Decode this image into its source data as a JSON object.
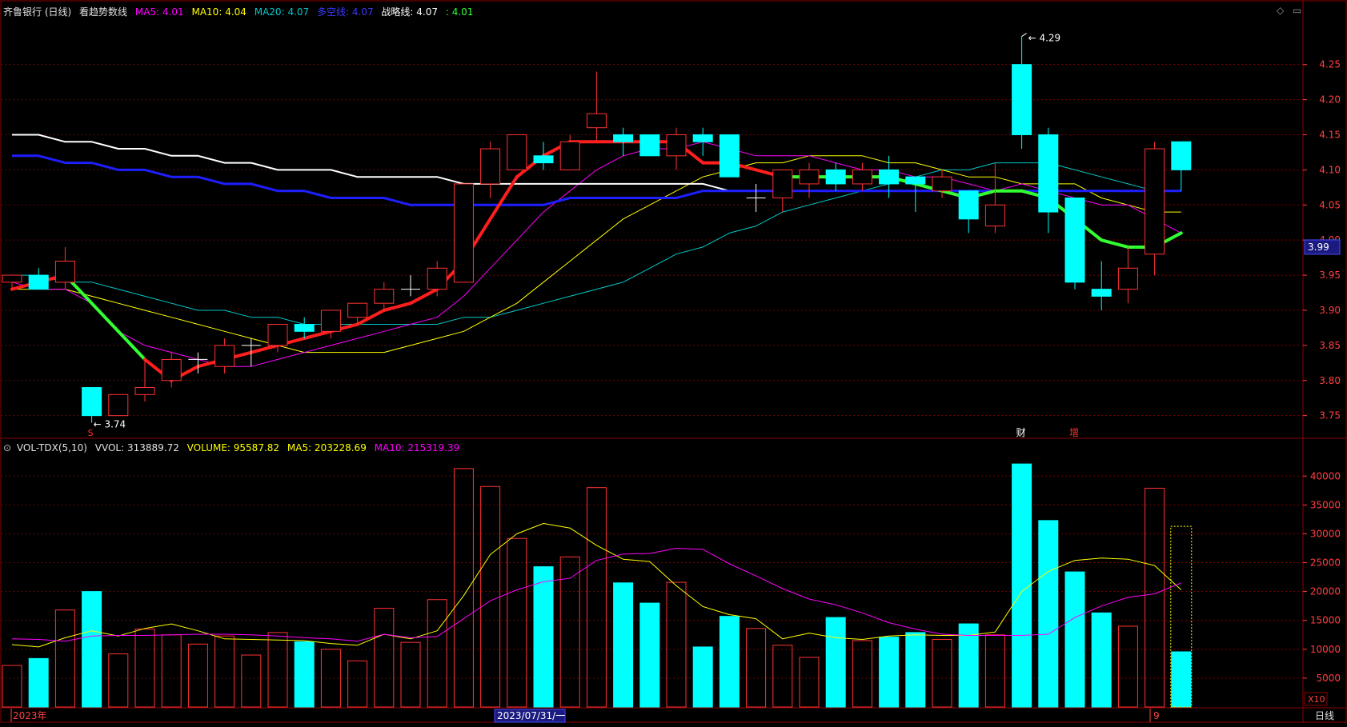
{
  "colors": {
    "up": "#ff3232",
    "down": "#00ffff",
    "grid": "#7a0000",
    "frame": "#8b0000",
    "ma5": "#ff00ff",
    "ma10": "#ffff00",
    "ma20": "#00c8c8",
    "duokong": "#1e1eff",
    "zhanlue": "#ffffff",
    "trend_red": "#ff1e1e",
    "trend_green": "#32ff32",
    "axis_text": "#ff4040",
    "price_label_bg": "#1a1a80"
  },
  "header": {
    "title": "齐鲁银行 (日线)",
    "indicator": "看趋势数线",
    "ma5_label": "MA5:",
    "ma5_value": "4.01",
    "ma10_label": "MA10:",
    "ma10_value": "4.04",
    "ma20_label": "MA20:",
    "ma20_value": "4.07",
    "duokong_label": "多空线:",
    "duokong_value": "4.07",
    "zhanlue_label": "战略线:",
    "zhanlue_value": "4.07",
    "trend_label": ":",
    "trend_value": "4.01"
  },
  "vol_header": {
    "name": "VOL-TDX(5,10)",
    "vvol": "VVOL: 313889.72",
    "volume": "VOLUME: 95587.82",
    "ma5": "MA5: 203228.69",
    "ma10": "MA10: 215319.39"
  },
  "icons": {
    "diamond": "diamond-icon",
    "window": "window-icon"
  },
  "price_axis_labels": [
    "4.25",
    "4.20",
    "4.15",
    "4.10",
    "4.05",
    "4.00",
    "3.95",
    "3.90",
    "3.85",
    "3.80",
    "3.75"
  ],
  "current_price_label": "3.99",
  "vol_axis_labels": [
    "40000",
    "35000",
    "30000",
    "25000",
    "20000",
    "15000",
    "10000",
    "5000"
  ],
  "vol_unit": "X10",
  "annotations": {
    "high": "4.29",
    "low": "3.74",
    "marker_s": "S",
    "marker_cai": "财",
    "marker_zeng": "增"
  },
  "x_axis": {
    "left_label": "2023年",
    "cursor_date": "2023/07/31/一",
    "month_label": "9",
    "period": "日线"
  },
  "chart_data": {
    "type": "candlestick",
    "ylim": [
      3.72,
      4.31
    ],
    "vol_ylim": [
      0,
      43500
    ],
    "candles": [
      {
        "o": 3.94,
        "h": 3.95,
        "l": 3.93,
        "c": 3.95,
        "v": 7200
      },
      {
        "o": 3.95,
        "h": 3.96,
        "l": 3.93,
        "c": 3.93,
        "v": 8400
      },
      {
        "o": 3.94,
        "h": 3.99,
        "l": 3.93,
        "c": 3.97,
        "v": 16800
      },
      {
        "o": 3.79,
        "h": 3.79,
        "l": 3.74,
        "c": 3.75,
        "v": 20000
      },
      {
        "o": 3.75,
        "h": 3.78,
        "l": 3.75,
        "c": 3.78,
        "v": 9200
      },
      {
        "o": 3.78,
        "h": 3.83,
        "l": 3.77,
        "c": 3.79,
        "v": 13500
      },
      {
        "o": 3.8,
        "h": 3.84,
        "l": 3.79,
        "c": 3.83,
        "v": 12500
      },
      {
        "o": 3.83,
        "h": 3.84,
        "l": 3.81,
        "c": 3.83,
        "v": 10900
      },
      {
        "o": 3.82,
        "h": 3.86,
        "l": 3.81,
        "c": 3.85,
        "v": 12300
      },
      {
        "o": 3.85,
        "h": 3.86,
        "l": 3.82,
        "c": 3.85,
        "v": 9000
      },
      {
        "o": 3.85,
        "h": 3.88,
        "l": 3.84,
        "c": 3.88,
        "v": 12900
      },
      {
        "o": 3.88,
        "h": 3.89,
        "l": 3.86,
        "c": 3.87,
        "v": 11300
      },
      {
        "o": 3.87,
        "h": 3.9,
        "l": 3.86,
        "c": 3.9,
        "v": 10000
      },
      {
        "o": 3.89,
        "h": 3.91,
        "l": 3.88,
        "c": 3.91,
        "v": 8000
      },
      {
        "o": 3.91,
        "h": 3.94,
        "l": 3.9,
        "c": 3.93,
        "v": 17100
      },
      {
        "o": 3.93,
        "h": 3.95,
        "l": 3.92,
        "c": 3.93,
        "v": 11200
      },
      {
        "o": 3.93,
        "h": 3.97,
        "l": 3.92,
        "c": 3.96,
        "v": 18600
      },
      {
        "o": 3.94,
        "h": 4.08,
        "l": 3.94,
        "c": 4.08,
        "v": 41300
      },
      {
        "o": 4.08,
        "h": 4.14,
        "l": 4.06,
        "c": 4.13,
        "v": 38200
      },
      {
        "o": 4.1,
        "h": 4.15,
        "l": 4.1,
        "c": 4.15,
        "v": 29200
      },
      {
        "o": 4.12,
        "h": 4.14,
        "l": 4.1,
        "c": 4.11,
        "v": 24300
      },
      {
        "o": 4.1,
        "h": 4.15,
        "l": 4.1,
        "c": 4.14,
        "v": 26000
      },
      {
        "o": 4.16,
        "h": 4.24,
        "l": 4.14,
        "c": 4.18,
        "v": 38000
      },
      {
        "o": 4.15,
        "h": 4.16,
        "l": 4.12,
        "c": 4.14,
        "v": 21500
      },
      {
        "o": 4.15,
        "h": 4.15,
        "l": 4.12,
        "c": 4.12,
        "v": 18000
      },
      {
        "o": 4.12,
        "h": 4.16,
        "l": 4.1,
        "c": 4.15,
        "v": 21600
      },
      {
        "o": 4.15,
        "h": 4.16,
        "l": 4.12,
        "c": 4.14,
        "v": 10400
      },
      {
        "o": 4.15,
        "h": 4.15,
        "l": 4.09,
        "c": 4.09,
        "v": 15700
      },
      {
        "o": 4.06,
        "h": 4.08,
        "l": 4.04,
        "c": 4.06,
        "v": 13600
      },
      {
        "o": 4.06,
        "h": 4.1,
        "l": 4.04,
        "c": 4.1,
        "v": 10700
      },
      {
        "o": 4.08,
        "h": 4.11,
        "l": 4.06,
        "c": 4.1,
        "v": 8600
      },
      {
        "o": 4.1,
        "h": 4.11,
        "l": 4.07,
        "c": 4.08,
        "v": 15500
      },
      {
        "o": 4.08,
        "h": 4.11,
        "l": 4.07,
        "c": 4.1,
        "v": 11500
      },
      {
        "o": 4.1,
        "h": 4.12,
        "l": 4.06,
        "c": 4.08,
        "v": 12100
      },
      {
        "o": 4.09,
        "h": 4.09,
        "l": 4.04,
        "c": 4.08,
        "v": 12900
      },
      {
        "o": 4.07,
        "h": 4.1,
        "l": 4.06,
        "c": 4.09,
        "v": 11700
      },
      {
        "o": 4.07,
        "h": 4.07,
        "l": 4.01,
        "c": 4.03,
        "v": 14400
      },
      {
        "o": 4.02,
        "h": 4.11,
        "l": 4.01,
        "c": 4.05,
        "v": 12500
      },
      {
        "o": 4.25,
        "h": 4.29,
        "l": 4.13,
        "c": 4.15,
        "v": 42100
      },
      {
        "o": 4.15,
        "h": 4.16,
        "l": 4.01,
        "c": 4.04,
        "v": 32300
      },
      {
        "o": 4.06,
        "h": 4.06,
        "l": 3.93,
        "c": 3.94,
        "v": 23400
      },
      {
        "o": 3.93,
        "h": 3.97,
        "l": 3.9,
        "c": 3.92,
        "v": 16300
      },
      {
        "o": 3.93,
        "h": 3.99,
        "l": 3.91,
        "c": 3.96,
        "v": 14000
      },
      {
        "o": 3.98,
        "h": 4.14,
        "l": 3.95,
        "c": 4.13,
        "v": 37900
      },
      {
        "o": 4.14,
        "h": 4.14,
        "l": 4.07,
        "c": 4.1,
        "v": 9560
      }
    ],
    "ma5": [
      3.94,
      3.93,
      3.93,
      3.91,
      3.87,
      3.85,
      3.84,
      3.83,
      3.82,
      3.82,
      3.83,
      3.84,
      3.85,
      3.86,
      3.87,
      3.88,
      3.89,
      3.92,
      3.96,
      4.0,
      4.04,
      4.07,
      4.1,
      4.12,
      4.13,
      4.13,
      4.14,
      4.13,
      4.12,
      4.12,
      4.12,
      4.11,
      4.1,
      4.1,
      4.09,
      4.09,
      4.08,
      4.07,
      4.08,
      4.07,
      4.06,
      4.05,
      4.05,
      4.03,
      4.01
    ],
    "ma10": [
      3.93,
      3.93,
      3.93,
      3.92,
      3.91,
      3.9,
      3.89,
      3.88,
      3.87,
      3.86,
      3.85,
      3.84,
      3.84,
      3.84,
      3.84,
      3.85,
      3.86,
      3.87,
      3.89,
      3.91,
      3.94,
      3.97,
      4.0,
      4.03,
      4.05,
      4.07,
      4.09,
      4.1,
      4.11,
      4.11,
      4.12,
      4.12,
      4.12,
      4.11,
      4.11,
      4.1,
      4.09,
      4.09,
      4.08,
      4.08,
      4.08,
      4.06,
      4.05,
      4.04,
      4.04
    ],
    "ma20": [
      3.95,
      3.95,
      3.94,
      3.94,
      3.93,
      3.92,
      3.91,
      3.9,
      3.9,
      3.89,
      3.89,
      3.88,
      3.88,
      3.88,
      3.88,
      3.88,
      3.88,
      3.89,
      3.89,
      3.9,
      3.91,
      3.92,
      3.93,
      3.94,
      3.96,
      3.98,
      3.99,
      4.01,
      4.02,
      4.04,
      4.05,
      4.06,
      4.07,
      4.08,
      4.09,
      4.1,
      4.1,
      4.11,
      4.11,
      4.11,
      4.1,
      4.09,
      4.08,
      4.07,
      4.07
    ],
    "duokong": [
      4.12,
      4.12,
      4.11,
      4.11,
      4.1,
      4.1,
      4.09,
      4.09,
      4.08,
      4.08,
      4.07,
      4.07,
      4.06,
      4.06,
      4.06,
      4.05,
      4.05,
      4.05,
      4.05,
      4.05,
      4.05,
      4.06,
      4.06,
      4.06,
      4.06,
      4.06,
      4.07,
      4.07,
      4.07,
      4.07,
      4.07,
      4.07,
      4.07,
      4.07,
      4.07,
      4.07,
      4.07,
      4.07,
      4.07,
      4.07,
      4.07,
      4.07,
      4.07,
      4.07,
      4.07
    ],
    "zhanlue": [
      4.15,
      4.15,
      4.14,
      4.14,
      4.13,
      4.13,
      4.12,
      4.12,
      4.11,
      4.11,
      4.1,
      4.1,
      4.1,
      4.09,
      4.09,
      4.09,
      4.09,
      4.08,
      4.08,
      4.08,
      4.08,
      4.08,
      4.08,
      4.08,
      4.08,
      4.08,
      4.08,
      4.07,
      4.07,
      4.07,
      4.07,
      4.07,
      4.07,
      4.07,
      4.07,
      4.07,
      4.07,
      4.07,
      4.07,
      4.07,
      4.07,
      4.07,
      4.07,
      4.07,
      4.07
    ],
    "trend": [
      3.93,
      3.94,
      3.95,
      3.91,
      3.87,
      3.83,
      3.8,
      3.82,
      3.83,
      3.84,
      3.85,
      3.86,
      3.87,
      3.88,
      3.9,
      3.91,
      3.93,
      3.97,
      4.03,
      4.09,
      4.12,
      4.14,
      4.14,
      4.14,
      4.14,
      4.14,
      4.11,
      4.11,
      4.1,
      4.09,
      4.09,
      4.09,
      4.09,
      4.09,
      4.08,
      4.07,
      4.06,
      4.07,
      4.07,
      4.06,
      4.03,
      4.0,
      3.99,
      3.99,
      4.01
    ],
    "trend_color": [
      "r",
      "r",
      "r",
      "g",
      "g",
      "g",
      "r",
      "r",
      "r",
      "r",
      "r",
      "r",
      "r",
      "r",
      "r",
      "r",
      "r",
      "r",
      "r",
      "r",
      "r",
      "r",
      "r",
      "r",
      "r",
      "r",
      "r",
      "r",
      "r",
      "r",
      "g",
      "g",
      "g",
      "g",
      "g",
      "g",
      "g",
      "g",
      "g",
      "g",
      "g",
      "g",
      "g",
      "g",
      "g"
    ],
    "vol_ma5": [
      10800,
      10400,
      12000,
      13200,
      12300,
      13600,
      14400,
      13200,
      11800,
      11700,
      11600,
      11500,
      11000,
      10700,
      12600,
      11800,
      13200,
      19300,
      26400,
      30000,
      31800,
      31000,
      28000,
      25600,
      25200,
      21000,
      17400,
      16000,
      15300,
      11800,
      12800,
      12000,
      11700,
      12300,
      12500,
      12400,
      12400,
      13000,
      20000,
      23500,
      25400,
      25800,
      25600,
      24500,
      20300
    ],
    "vol_ma10": [
      11800,
      11700,
      11400,
      12300,
      12400,
      12400,
      12500,
      12600,
      12600,
      12500,
      12300,
      12000,
      11800,
      11400,
      12600,
      12000,
      12200,
      15300,
      18400,
      20300,
      21700,
      22300,
      25400,
      26500,
      26600,
      27500,
      27300,
      24800,
      22700,
      20500,
      18700,
      17700,
      16300,
      14600,
      13500,
      12600,
      12400,
      12400,
      12400,
      12600,
      15500,
      17500,
      19000,
      19600,
      21500
    ]
  }
}
